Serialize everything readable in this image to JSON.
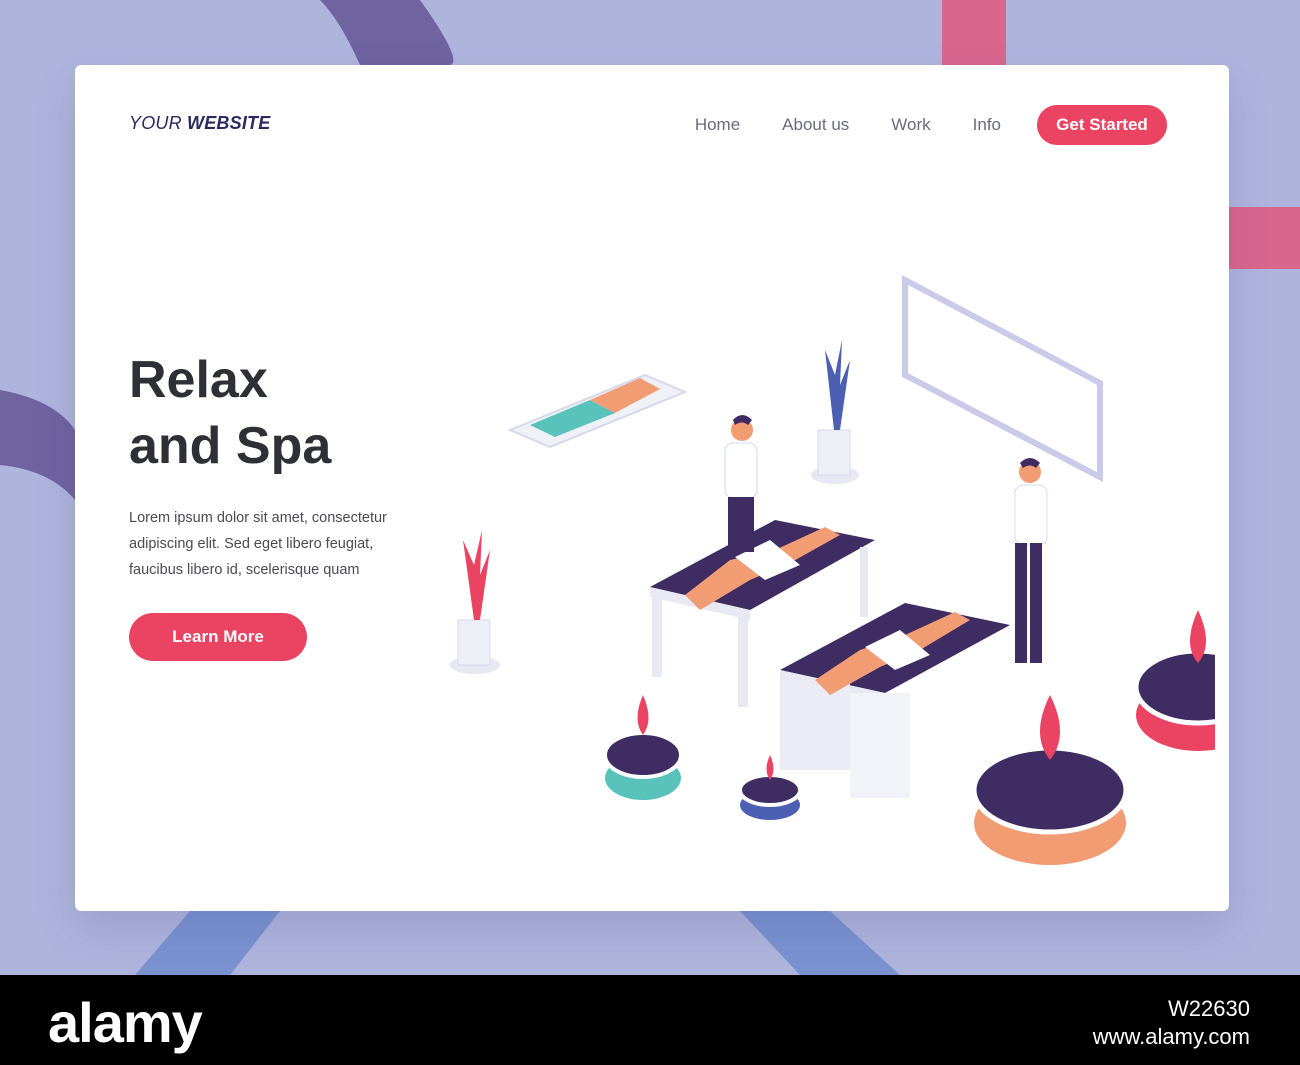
{
  "brand_logo": {
    "prefix": "YOUR ",
    "bold": "WEBSITE"
  },
  "nav": {
    "items": [
      "Home",
      "About us",
      "Work",
      "Info"
    ],
    "cta": "Get Started"
  },
  "hero": {
    "title_line1": "Relax",
    "title_line2": "and Spa",
    "body": "Lorem ipsum dolor sit amet, consectetur adipiscing elit. Sed eget libero feugiat, faucibus libero id, scelerisque quam",
    "button": "Learn More"
  },
  "footer": {
    "brand": "alamy",
    "image_id": "W22630",
    "site": "www.alamy.com"
  },
  "colors": {
    "accent": "#ea4462",
    "background": "#aeb4dc",
    "dark_purple": "#6f63a0"
  }
}
